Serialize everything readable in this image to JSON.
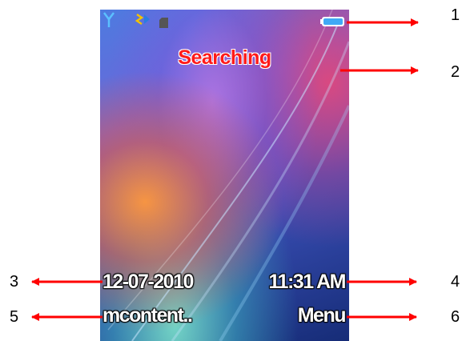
{
  "status": {
    "signal_icon": "antenna-signal-icon",
    "network_icon": "network-indicator-icon",
    "sim_icon": "sim-card-icon",
    "battery_icon": "battery-icon"
  },
  "screen": {
    "network_status": "Searching",
    "date": "12-07-2010",
    "time": "11:31 AM",
    "left_softkey": "mcontent..",
    "right_softkey": "Menu"
  },
  "callouts": [
    "1",
    "2",
    "3",
    "4",
    "5",
    "6"
  ],
  "colors": {
    "searching_text": "#ff1a1a",
    "arrow": "#ff0000",
    "battery": "#3fa9f5",
    "signal": "#5bc0ff"
  }
}
